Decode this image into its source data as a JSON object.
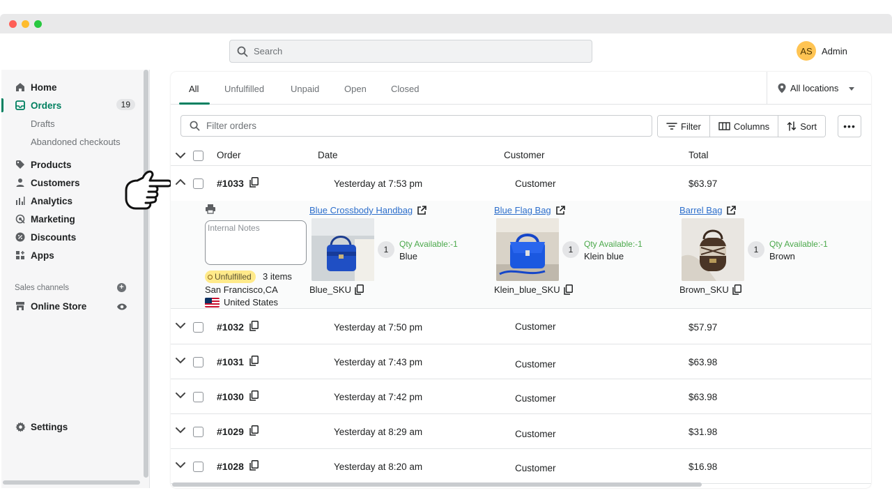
{
  "window": {
    "traffic_lights": [
      "close",
      "minimize",
      "zoom"
    ]
  },
  "topbar": {
    "search_placeholder": "Search",
    "user": {
      "initials": "AS",
      "name": "Admin"
    }
  },
  "sidebar": {
    "items": [
      {
        "label": "Home",
        "icon": "home-icon"
      },
      {
        "label": "Orders",
        "icon": "orders-icon",
        "badge": "19",
        "active": true
      },
      {
        "label": "Drafts",
        "sub": true
      },
      {
        "label": "Abandoned checkouts",
        "sub": true
      },
      {
        "label": "Products",
        "icon": "tag-icon"
      },
      {
        "label": "Customers",
        "icon": "person-icon"
      },
      {
        "label": "Analytics",
        "icon": "bar-chart-icon"
      },
      {
        "label": "Marketing",
        "icon": "target-icon"
      },
      {
        "label": "Discounts",
        "icon": "discount-icon"
      },
      {
        "label": "Apps",
        "icon": "apps-icon"
      }
    ],
    "sales_channels_label": "Sales channels",
    "online_store_label": "Online Store",
    "settings_label": "Settings"
  },
  "tabs": [
    "All",
    "Unfulfilled",
    "Unpaid",
    "Open",
    "Closed"
  ],
  "active_tab": "All",
  "locations_label": "All locations",
  "filter_placeholder": "Filter orders",
  "buttons": {
    "filter": "Filter",
    "columns": "Columns",
    "sort": "Sort",
    "more": "•••"
  },
  "columns": {
    "order": "Order",
    "date": "Date",
    "customer": "Customer",
    "total": "Total"
  },
  "expanded_order": {
    "id": "#1033",
    "date": "Yesterday at 7:53 pm",
    "customer": "Customer",
    "total": "$63.97",
    "notes_placeholder": "Internal Notes",
    "status": "Unfulfilled",
    "items_count": "3 items",
    "city": "San Francisco,CA",
    "country": "United States",
    "products": [
      {
        "name": "Blue Crossbody Handbag",
        "qty": "1",
        "availability": "Qty Available:-1",
        "variant": "Blue",
        "sku": "Blue_SKU"
      },
      {
        "name": "Blue Flag Bag",
        "qty": "1",
        "availability": "Qty Available:-1",
        "variant": "Klein blue",
        "sku": "Klein_blue_SKU"
      },
      {
        "name": "Barrel Bag",
        "qty": "1",
        "availability": "Qty Available:-1",
        "variant": "Brown",
        "sku": "Brown_SKU"
      }
    ]
  },
  "orders": [
    {
      "id": "#1032",
      "date": "Yesterday at 7:50 pm",
      "customer": "Customer",
      "total": "$57.97"
    },
    {
      "id": "#1031",
      "date": "Yesterday at 7:43 pm",
      "customer": "Customer",
      "total": "$63.98"
    },
    {
      "id": "#1030",
      "date": "Yesterday at 7:42 pm",
      "customer": "Customer",
      "total": "$63.98"
    },
    {
      "id": "#1029",
      "date": "Yesterday at 8:29 am",
      "customer": "Customer",
      "total": "$31.98"
    },
    {
      "id": "#1028",
      "date": "Yesterday at 8:20 am",
      "customer": "Customer",
      "total": "$16.98"
    }
  ],
  "colors": {
    "accent": "#008060",
    "link": "#2c6ecb",
    "unfulfilled_badge": "#ffea8a",
    "avatar": "#ffc453",
    "availability": "#4aa84a"
  }
}
